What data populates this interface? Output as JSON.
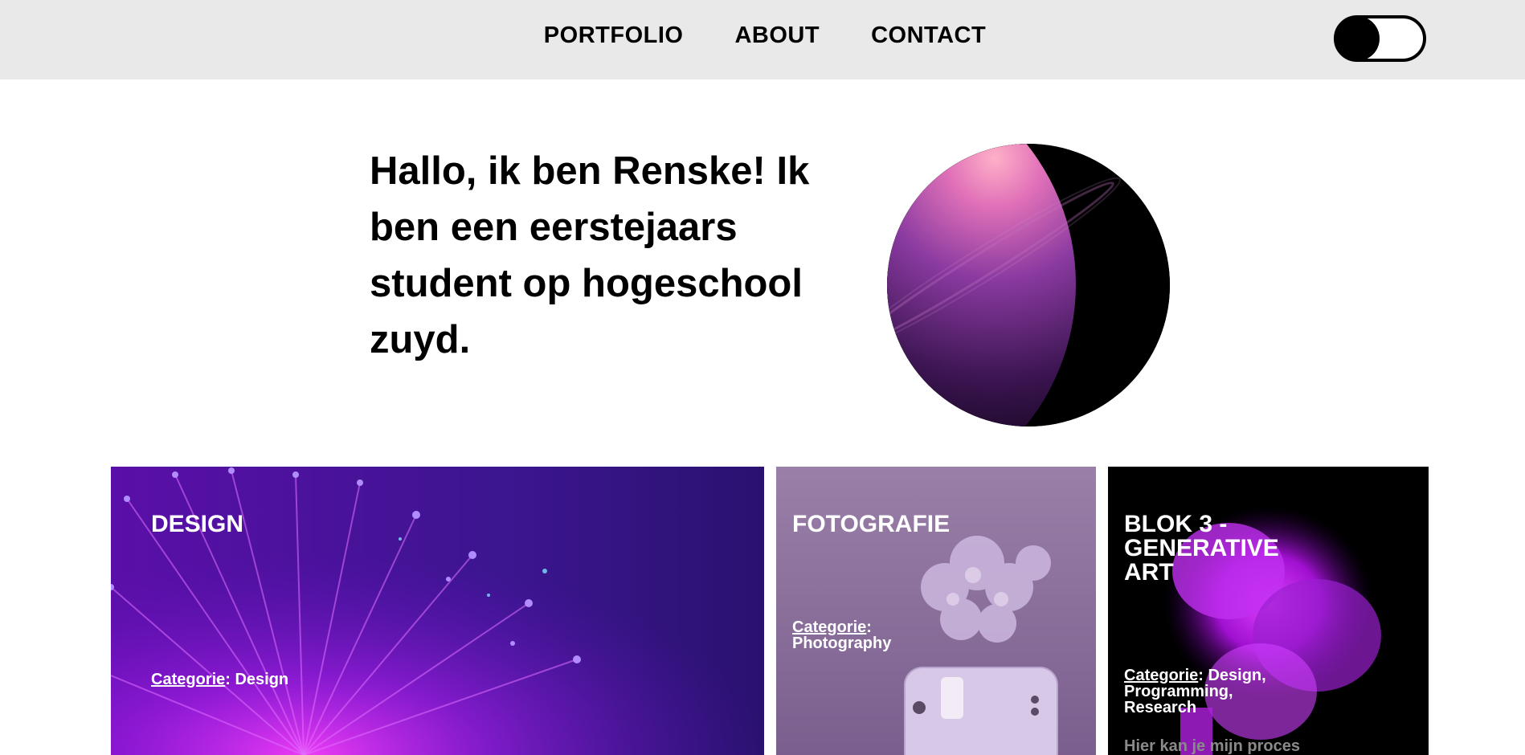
{
  "nav": {
    "links": [
      "PORTFOLIO",
      "ABOUT",
      "CONTACT"
    ]
  },
  "theme_toggle": {
    "state": "off"
  },
  "hero": {
    "text": "Hallo, ik ben Renske! Ik ben een eerstejaars student op hogeschool zuyd.",
    "image_alt": "planet"
  },
  "projects": [
    {
      "title": "DESIGN",
      "category_label": "Categorie",
      "category_value": ": Design",
      "background": "purple fiber optic lights"
    },
    {
      "title": "FOTOGRAFIE",
      "category_label": "Categorie",
      "category_value": ": Photography",
      "background": "lilac flowers and instax camera"
    },
    {
      "title": "BLOK 3 - GENERATIVE ART",
      "category_label": "Categorie",
      "category_value": ": Design, Programming, Research",
      "description": "Hier kan je mijn proces",
      "background": "magenta ink in black"
    }
  ],
  "colors": {
    "nav_bg": "#e9e9e9",
    "text": "#000000",
    "accent_purple": "#6a1fd0",
    "card_text": "#ffffff"
  },
  "icons": {
    "theme_toggle": "toggle-switch-icon"
  }
}
